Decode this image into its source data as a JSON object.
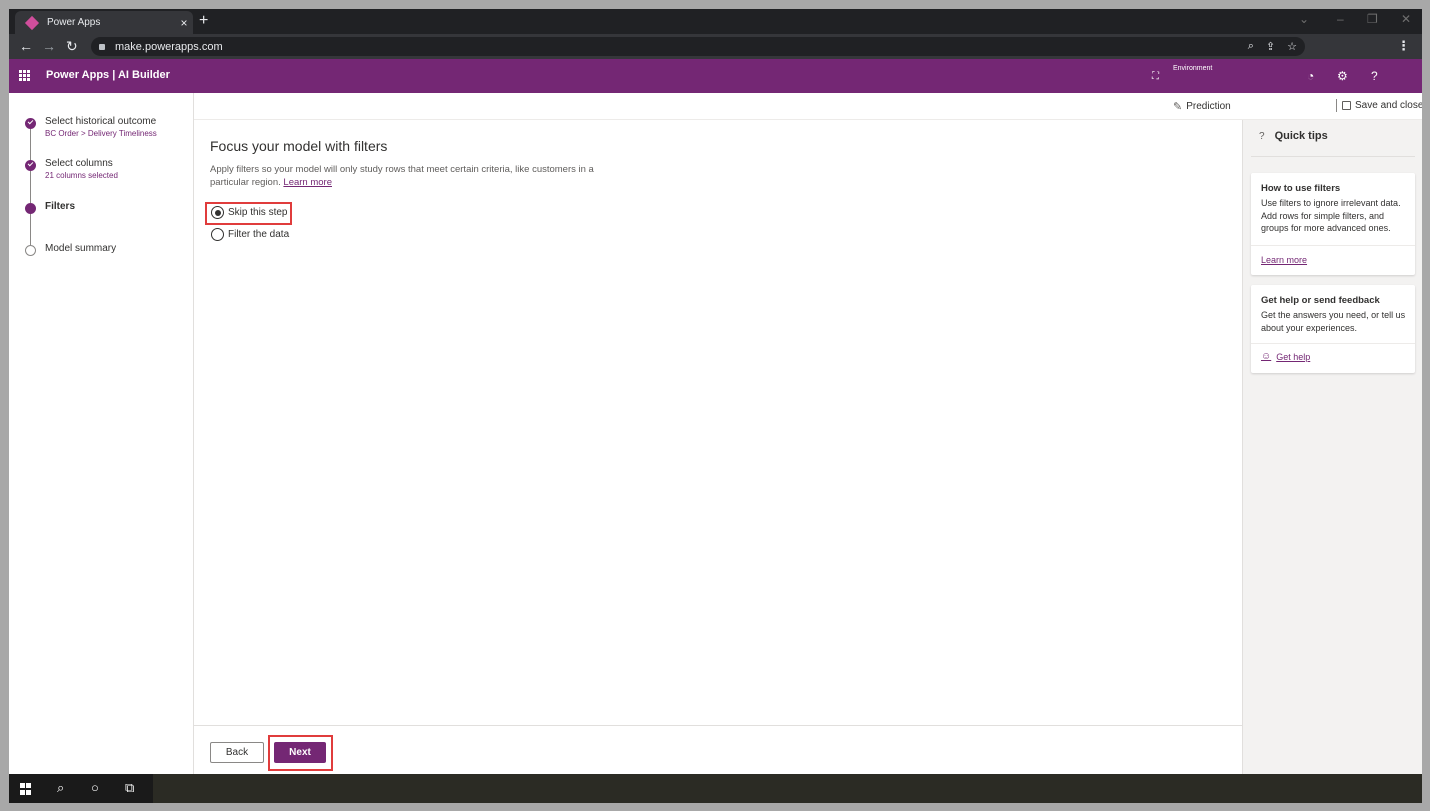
{
  "browser": {
    "tab_title": "Power Apps",
    "tab_close": "×",
    "new_tab": "+",
    "url": "make.powerapps.com"
  },
  "header": {
    "title": "Power Apps  |  AI Builder",
    "environment_label": "Environment"
  },
  "steps": [
    {
      "label": "Select historical outcome",
      "sub": "BC Order > Delivery Timeliness",
      "state": "done"
    },
    {
      "label": "Select columns",
      "sub": "21 columns selected",
      "state": "done"
    },
    {
      "label": "Filters",
      "sub": "",
      "state": "current"
    },
    {
      "label": "Model summary",
      "sub": "",
      "state": "todo"
    }
  ],
  "command_bar": {
    "prediction_label": "Prediction",
    "save_close_label": "Save and close"
  },
  "main": {
    "title": "Focus your model with filters",
    "description": "Apply filters so your model will only study rows that meet certain criteria, like customers in a particular region.",
    "learn_more": "Learn more",
    "options": [
      {
        "label": "Skip this step",
        "checked": true
      },
      {
        "label": "Filter the data",
        "checked": false
      }
    ]
  },
  "footer": {
    "back_label": "Back",
    "next_label": "Next"
  },
  "quick_tips": {
    "title": "Quick tips",
    "cards": [
      {
        "title": "How to use filters",
        "body": "Use filters to ignore irrelevant data. Add rows for simple filters, and groups for more advanced ones.",
        "link": "Learn more"
      },
      {
        "title": "Get help or send feedback",
        "body": "Get the answers you need, or tell us about your experiences.",
        "link": "Get help"
      }
    ]
  },
  "colors": {
    "brand": "#742774",
    "highlight": "#e03c3c"
  }
}
